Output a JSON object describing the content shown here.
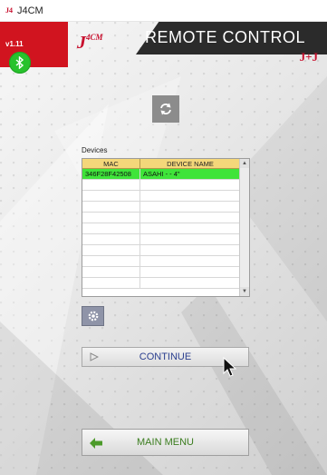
{
  "window": {
    "app_icon": "J4",
    "title": "J4CM"
  },
  "header": {
    "version": "v1.11",
    "title": "REMOTE CONTROL",
    "logo_main": "J",
    "logo_sup": "4CM",
    "logo_brand": "J+J"
  },
  "icons": {
    "bluetooth": "bluetooth-icon",
    "refresh": "refresh-icon",
    "settings": "gear-icon",
    "play": "play-icon",
    "back": "back-arrow-icon"
  },
  "devices": {
    "label": "Devices",
    "columns": [
      "MAC",
      "DEVICE NAME"
    ],
    "rows": [
      {
        "mac": "346F28F42508",
        "name": "ASAHI - - 4\"",
        "selected": true
      },
      {
        "mac": "",
        "name": ""
      },
      {
        "mac": "",
        "name": ""
      },
      {
        "mac": "",
        "name": ""
      },
      {
        "mac": "",
        "name": ""
      },
      {
        "mac": "",
        "name": ""
      },
      {
        "mac": "",
        "name": ""
      },
      {
        "mac": "",
        "name": ""
      },
      {
        "mac": "",
        "name": ""
      },
      {
        "mac": "",
        "name": ""
      },
      {
        "mac": "",
        "name": ""
      }
    ]
  },
  "buttons": {
    "continue": "CONTINUE",
    "main_menu": "MAIN MENU"
  },
  "colors": {
    "brand_red": "#c8102e",
    "bluetooth_green": "#27c22c",
    "selected_row": "#3fe43a",
    "continue_text": "#2b3f8f",
    "menu_text": "#3b7d1f"
  }
}
